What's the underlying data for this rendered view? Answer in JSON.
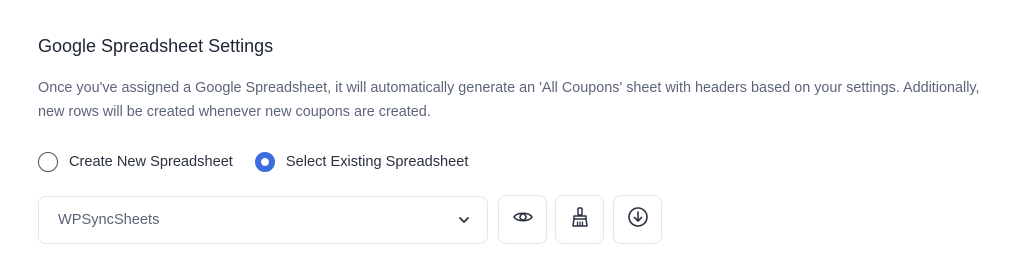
{
  "section": {
    "title": "Google Spreadsheet Settings",
    "description": "Once you've assigned a Google Spreadsheet, it will automatically generate an 'All Coupons' sheet with headers based on your settings. Additionally, new rows will be created whenever new coupons are created."
  },
  "radio": {
    "options": [
      {
        "label": "Create New Spreadsheet",
        "checked": false
      },
      {
        "label": "Select Existing Spreadsheet",
        "checked": true
      }
    ]
  },
  "spreadsheet_select": {
    "value": "WPSyncSheets"
  },
  "buttons": {
    "view_icon": "eye-icon",
    "clear_icon": "broom-icon",
    "download_icon": "download-circle-icon"
  },
  "colors": {
    "accent": "#3b6de0",
    "title": "#1d2433",
    "body_text": "#5c6678",
    "border": "#e3e6ec"
  }
}
